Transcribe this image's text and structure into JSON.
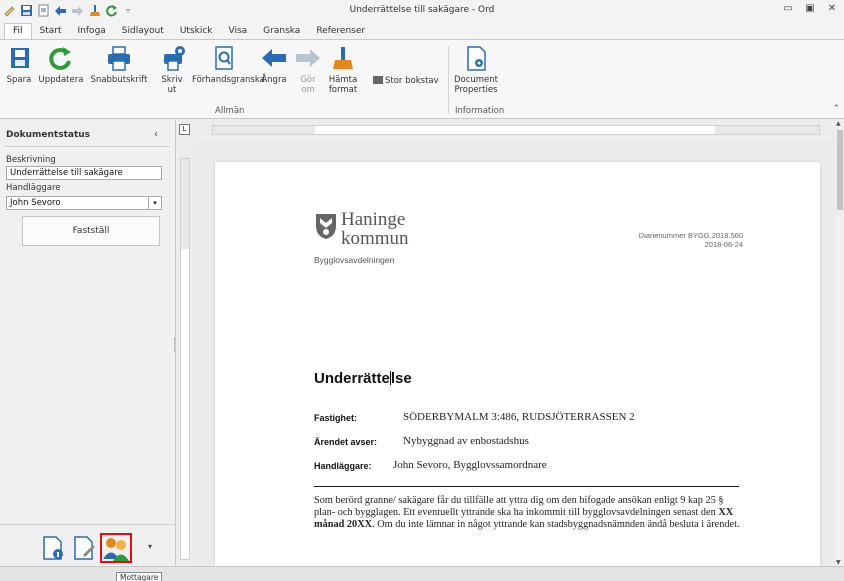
{
  "window": {
    "title": "Underrättelse till sakägare - Ord"
  },
  "qat": {
    "icons": [
      "edit-icon",
      "save-icon",
      "new-doc-icon",
      "back-arrow-icon",
      "forward-arrow-icon",
      "broom-icon",
      "refresh-icon",
      "dropdown-icon"
    ]
  },
  "tabs": [
    "Fil",
    "Start",
    "Infoga",
    "Sidlayout",
    "Utskick",
    "Visa",
    "Granska",
    "Referenser"
  ],
  "ribbon": {
    "buttons": {
      "save": "Spara",
      "update": "Uppdatera",
      "quickprint": "Snabbutskrift",
      "print_l1": "Skriv",
      "print_l2": "ut",
      "preview": "Förhandsgranska",
      "undo": "Ångra",
      "redo": "Gör om",
      "fetch_l1": "Hämta",
      "fetch_l2": "format",
      "uppercase": "Stor bokstav",
      "docprops_l1": "Document",
      "docprops_l2": "Properties"
    },
    "groups": {
      "general": "Allmän",
      "information": "Information"
    }
  },
  "panel": {
    "title": "Dokumentstatus",
    "description_label": "Beskrivning",
    "description_value": "Underrättelse till sakägare",
    "handler_label": "Handläggare",
    "handler_value": "John Sevoro",
    "confirm_button": "Fastställ"
  },
  "tooltip": "Mottagare",
  "document": {
    "logo_line1": "Haninge",
    "logo_line2": "kommun",
    "department": "Bygglovsavdelningen",
    "diarienummer": "Diarienummer BYGG.2018.560",
    "date": "2018-06-24",
    "heading_a": "Underrätte",
    "heading_b": "lse",
    "rows": [
      {
        "label": "Fastighet:",
        "value": "SÖDERBYMALM 3:486, RUDSJÖTERRASSEN 2"
      },
      {
        "label": "Ärendet avser:",
        "value": "Nybyggnad av enbostadshus"
      },
      {
        "label": "Handläggare:",
        "value": "John Sevoro, Bygglovssamordnare"
      }
    ],
    "body_1": "Som berörd granne/ sakägare får du tillfälle att yttra dig om den bifogade ansökan enligt 9 kap 25 § plan- och bygglagen. Ett eventuellt yttrande ska ha inkommit till bygglovsavdelningen senast den ",
    "body_bold": "XX månad 20XX",
    "body_2": ". Om du inte lämnar in något yttrande kan stadsbyggnadsnämnden ändå besluta i ärendet."
  },
  "colors": {
    "accent_blue": "#2b6cb0",
    "green_refresh": "#2e9a3a",
    "orange_broom": "#e08a1e",
    "selection_red": "#e01010"
  }
}
